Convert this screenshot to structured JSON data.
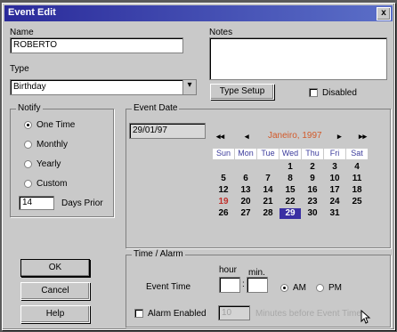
{
  "window": {
    "title": "Event Edit",
    "close_glyph": "x"
  },
  "name": {
    "label": "Name",
    "value": "ROBERTO"
  },
  "notes": {
    "label": "Notes",
    "value": ""
  },
  "type": {
    "label": "Type",
    "value": "Birthday",
    "setup_button": "Type Setup",
    "disabled_label": "Disabled"
  },
  "notify": {
    "title": "Notify",
    "options": [
      "One Time",
      "Monthly",
      "Yearly",
      "Custom"
    ],
    "selected": "One Time",
    "days_value": "14",
    "days_label": "Days Prior"
  },
  "event_date": {
    "title": "Event Date",
    "value": "29/01/97",
    "calendar": {
      "nav_first": "◂◂",
      "nav_prev": "◂",
      "nav_next": "▸",
      "nav_last": "▸▸",
      "month_label": "Janeiro, 1997",
      "weekdays": [
        "Sun",
        "Mon",
        "Tue",
        "Wed",
        "Thu",
        "Fri",
        "Sat"
      ],
      "weeks": [
        [
          "",
          "",
          "",
          "1",
          "2",
          "3",
          "4"
        ],
        [
          "5",
          "6",
          "7",
          "8",
          "9",
          "10",
          "11"
        ],
        [
          "12",
          "13",
          "14",
          "15",
          "16",
          "17",
          "18"
        ],
        [
          "19",
          "20",
          "21",
          "22",
          "23",
          "24",
          "25"
        ],
        [
          "26",
          "27",
          "28",
          "29",
          "30",
          "31",
          ""
        ]
      ],
      "selected_day": "29",
      "highlight_day": "19"
    }
  },
  "buttons": {
    "ok": "OK",
    "cancel": "Cancel",
    "help": "Help"
  },
  "time_alarm": {
    "title": "Time / Alarm",
    "event_time_label": "Event Time",
    "hour_label": "hour",
    "min_label": "min.",
    "hour_value": "",
    "min_value": "",
    "am_label": "AM",
    "pm_label": "PM",
    "selected": "AM",
    "alarm_label": "Alarm Enabled",
    "alarm_minutes": "10",
    "minutes_before_label": "Minutes before Event Time"
  },
  "colors": {
    "title_bar": "#2a2a9a",
    "selection": "#3a2fa3",
    "month_text": "#d25a2a"
  }
}
